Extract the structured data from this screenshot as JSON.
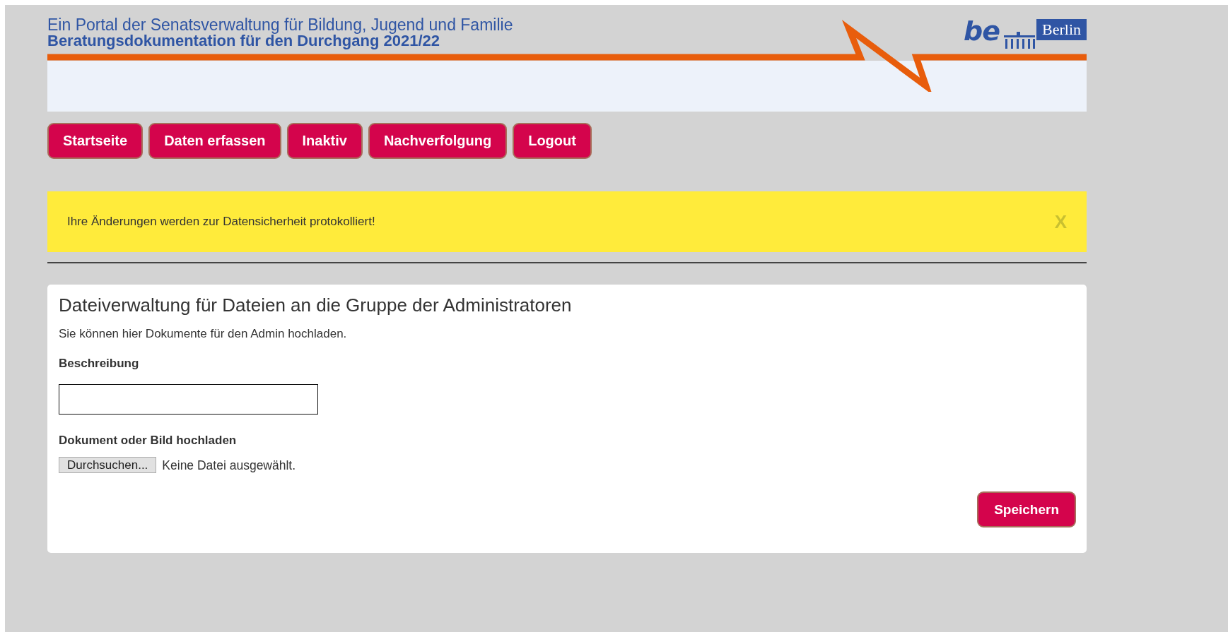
{
  "header": {
    "portal_title": "Ein Portal der Senatsverwaltung für Bildung, Jugend und Familie",
    "subtitle": "Beratungsdokumentation für den Durchgang 2021/22",
    "logo": {
      "mark": "be",
      "city": "Berlin"
    }
  },
  "nav": [
    {
      "label": "Startseite"
    },
    {
      "label": "Daten erfassen"
    },
    {
      "label": "Inaktiv"
    },
    {
      "label": "Nachverfolgung"
    },
    {
      "label": "Logout"
    }
  ],
  "alert": {
    "message": "Ihre Änderungen werden zur Datensicherheit protokolliert!",
    "close": "X"
  },
  "panel": {
    "title": "Dateiverwaltung für Dateien an die Gruppe der Administratoren",
    "intro": "Sie können hier Dokumente für den Admin hochladen.",
    "fields": [
      {
        "kind": "text",
        "label": "Beschreibung"
      },
      {
        "kind": "file",
        "label": "Dokument oder Bild hochladen",
        "button": "Durchsuchen...",
        "status": "Keine Datei ausgewählt."
      }
    ],
    "submit": "Speichern"
  }
}
